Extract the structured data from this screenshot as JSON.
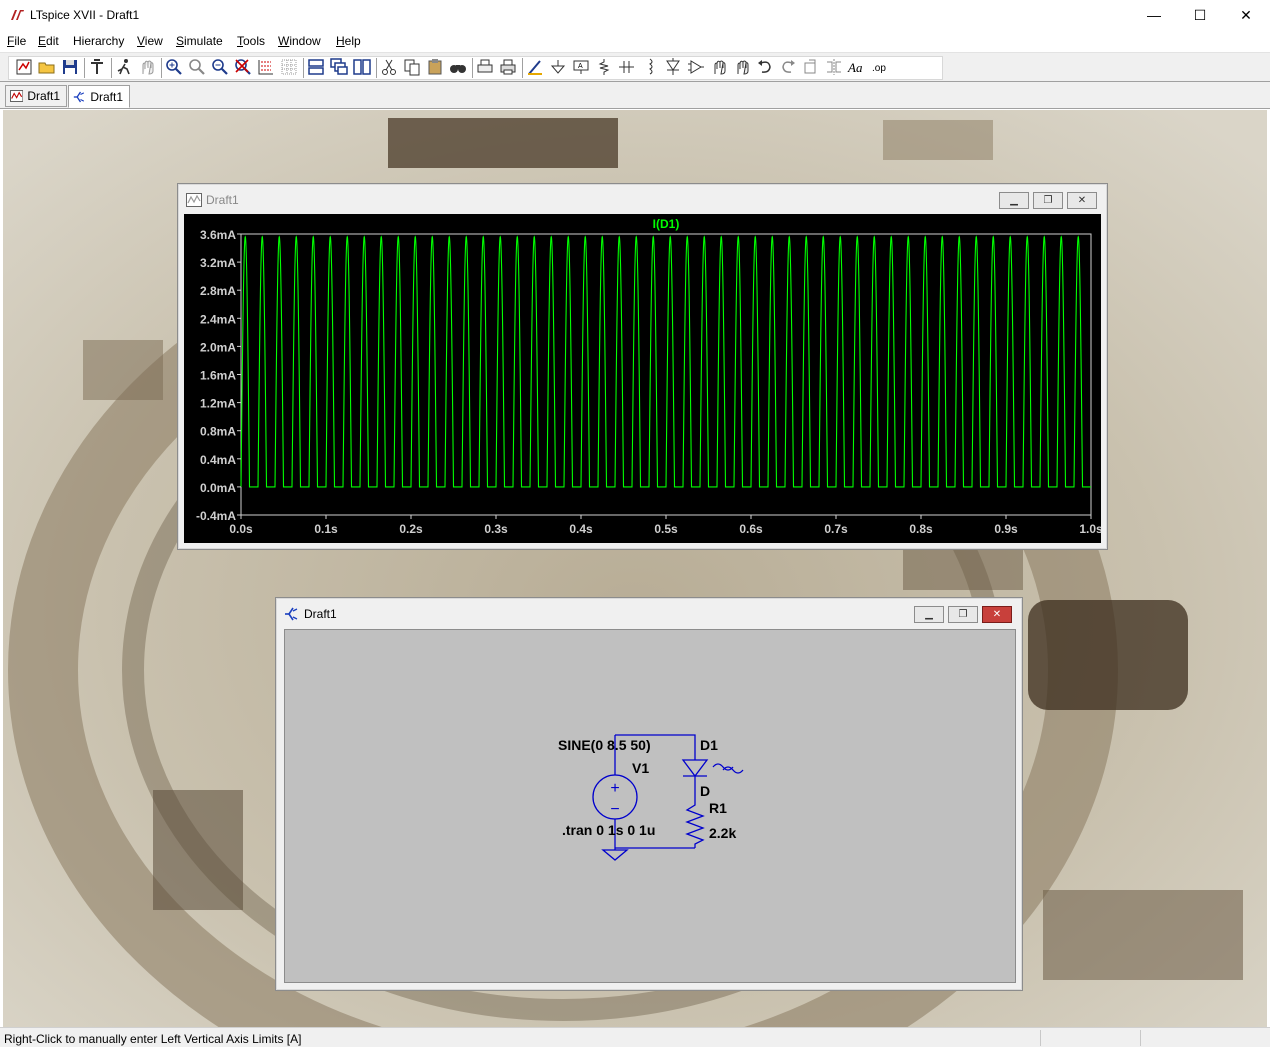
{
  "app": {
    "title": "LTspice XVII - Draft1"
  },
  "window_controls": {
    "minimize": "—",
    "maximize": "☐",
    "close": "✕"
  },
  "menu": [
    {
      "u": "F",
      "rest": "ile"
    },
    {
      "u": "E",
      "rest": "dit"
    },
    {
      "u": "",
      "rest": "Hierarchy"
    },
    {
      "u": "V",
      "rest": "iew"
    },
    {
      "u": "S",
      "rest": "imulate"
    },
    {
      "u": "T",
      "rest": "ools"
    },
    {
      "u": "W",
      "rest": "indow"
    },
    {
      "u": "H",
      "rest": "elp"
    }
  ],
  "toolbar_icons": [
    "new-schematic-icon",
    "open-icon",
    "save-icon",
    "control-panel-icon",
    "run-icon",
    "halt-icon",
    "zoom-in-icon",
    "zoom-full-icon",
    "zoom-out-icon",
    "zoom-cancel-icon",
    "autorange-icon",
    "grid-icon",
    "tile-horizontal-icon",
    "cascade-icon",
    "tile-vertical-icon",
    "cut-icon",
    "copy-icon",
    "paste-icon",
    "find-icon",
    "print-preview-icon",
    "print-icon",
    "wire-icon",
    "ground-icon",
    "label-net-icon",
    "resistor-icon",
    "capacitor-icon",
    "inductor-icon",
    "diode-icon",
    "component-icon",
    "move-icon",
    "drag-icon",
    "undo-icon",
    "redo-icon",
    "rotate-icon",
    "mirror-icon",
    "text-icon",
    "spice-directive-icon"
  ],
  "tabs": [
    {
      "label": "Draft1",
      "kind": "waveform"
    },
    {
      "label": "Draft1",
      "kind": "schematic"
    }
  ],
  "waveform_window": {
    "title": "Draft1",
    "trace_label": "I(D1)",
    "trace_color": "#00ff00",
    "axis_color": "#d0d0d0",
    "background": "#000000"
  },
  "schematic_window": {
    "title": "Draft1",
    "wire_color": "#0000cc",
    "labels": {
      "source_value": "SINE(0 8.5 50)",
      "source_name": "V1",
      "diode_name": "D1",
      "diode_model": "D",
      "resistor_name": "R1",
      "resistor_value": "2.2k",
      "tran_directive": ".tran 0 1s 0 1u",
      "plus_sign": "+",
      "minus_sign": "−"
    }
  },
  "chart_data": {
    "type": "line",
    "title": "I(D1)",
    "xlabel": "",
    "ylabel": "",
    "x_ticks": [
      "0.0s",
      "0.1s",
      "0.2s",
      "0.3s",
      "0.4s",
      "0.5s",
      "0.6s",
      "0.7s",
      "0.8s",
      "0.9s",
      "1.0s"
    ],
    "y_ticks": [
      "3.6mA",
      "3.2mA",
      "2.8mA",
      "2.4mA",
      "2.0mA",
      "1.6mA",
      "1.2mA",
      "0.8mA",
      "0.4mA",
      "0.0mA",
      "-0.4mA"
    ],
    "xlim": [
      0,
      1
    ],
    "ylim": [
      -0.4,
      3.6
    ],
    "series": [
      {
        "name": "I(D1)",
        "frequency_hz": 50,
        "peak_ma": 3.56,
        "min_ma": 0.0,
        "cycles": 50
      }
    ]
  },
  "status": {
    "text": "Right-Click to manually enter Left Vertical Axis Limits [A]"
  }
}
